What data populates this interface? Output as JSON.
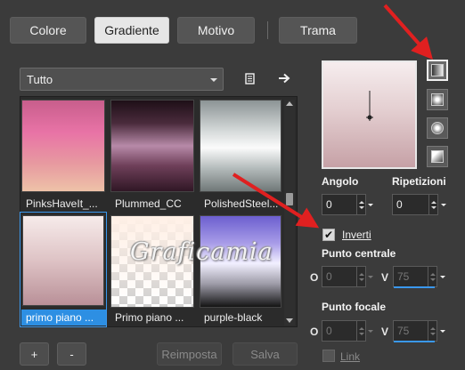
{
  "tabs": [
    {
      "label": "Colore",
      "active": false
    },
    {
      "label": "Gradiente",
      "active": true
    },
    {
      "label": "Motivo",
      "active": false
    },
    {
      "label": "Trama",
      "active": false
    }
  ],
  "category": {
    "value": "Tutto"
  },
  "toolbar": {
    "library_icon": "library-icon",
    "export_icon": "arrow-right-icon"
  },
  "gradients": [
    {
      "label": "PinksHaveIt_...",
      "selected": false
    },
    {
      "label": "Plummed_CC",
      "selected": false
    },
    {
      "label": "PolishedSteel...",
      "selected": false
    },
    {
      "label": "primo piano ...",
      "selected": true
    },
    {
      "label": "Primo piano ...",
      "selected": false
    },
    {
      "label": "purple-black",
      "selected": false
    }
  ],
  "buttons": {
    "add": "+",
    "remove": "-",
    "reset": "Reimposta",
    "save": "Salva"
  },
  "watermark": "Graficamia",
  "settings": {
    "angle_label": "Angolo",
    "angle_value": "0",
    "repeats_label": "Ripetizioni",
    "repeats_value": "0",
    "invert_label": "Inverti",
    "invert_checked": true,
    "center_label": "Punto centrale",
    "center_h_label": "O",
    "center_h_value": "0",
    "center_v_label": "V",
    "center_v_value": "75",
    "focal_label": "Punto focale",
    "focal_h_label": "O",
    "focal_h_value": "0",
    "focal_v_label": "V",
    "focal_v_value": "75",
    "link_label": "Link",
    "link_checked": false
  },
  "styles": [
    "linear-style-icon",
    "rectangular-style-icon",
    "radial-style-icon",
    "corner-style-icon"
  ],
  "colors": {
    "accent": "#2d8fe3",
    "arrow": "#e02020"
  }
}
